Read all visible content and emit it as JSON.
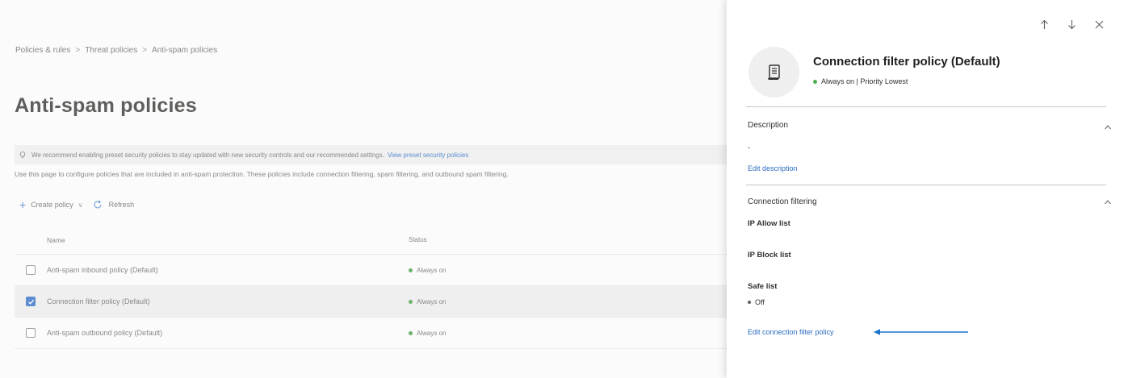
{
  "breadcrumb": [
    "Policies & rules",
    "Threat policies",
    "Anti-spam policies"
  ],
  "page_title": "Anti-spam policies",
  "info_bar": {
    "text": "We recommend enabling preset security policies to stay updated with new security controls and our recommended settings.",
    "link": "View preset security policies"
  },
  "description": "Use this page to configure policies that are included in anti-spam protection. These policies include connection filtering, spam filtering, and outbound spam filtering.",
  "toolbar": {
    "create_label": "Create policy",
    "refresh_label": "Refresh"
  },
  "table": {
    "columns": [
      "Name",
      "Status"
    ],
    "rows": [
      {
        "name": "Anti-spam inbound policy (Default)",
        "status": "Always on",
        "checked": false
      },
      {
        "name": "Connection filter policy (Default)",
        "status": "Always on",
        "checked": true
      },
      {
        "name": "Anti-spam outbound policy (Default)",
        "status": "Always on",
        "checked": false
      }
    ]
  },
  "flyout": {
    "title": "Connection filter policy (Default)",
    "status": "Always on",
    "priority": "Priority Lowest",
    "subtitle_sep": " | ",
    "description_section": {
      "heading": "Description",
      "value": "-",
      "edit_link": "Edit description"
    },
    "filtering_section": {
      "heading": "Connection filtering",
      "ip_allow_label": "IP Allow list",
      "ip_block_label": "IP Block list",
      "safe_list_label": "Safe list",
      "safe_list_value": "Off",
      "edit_link": "Edit connection filter policy"
    },
    "nav_icons": [
      "arrow-up-icon",
      "arrow-down-icon",
      "close-icon"
    ]
  },
  "colors": {
    "accent": "#2b6cbf",
    "status_on": "#4caf50",
    "annotation_arrow": "#1a73c8"
  }
}
